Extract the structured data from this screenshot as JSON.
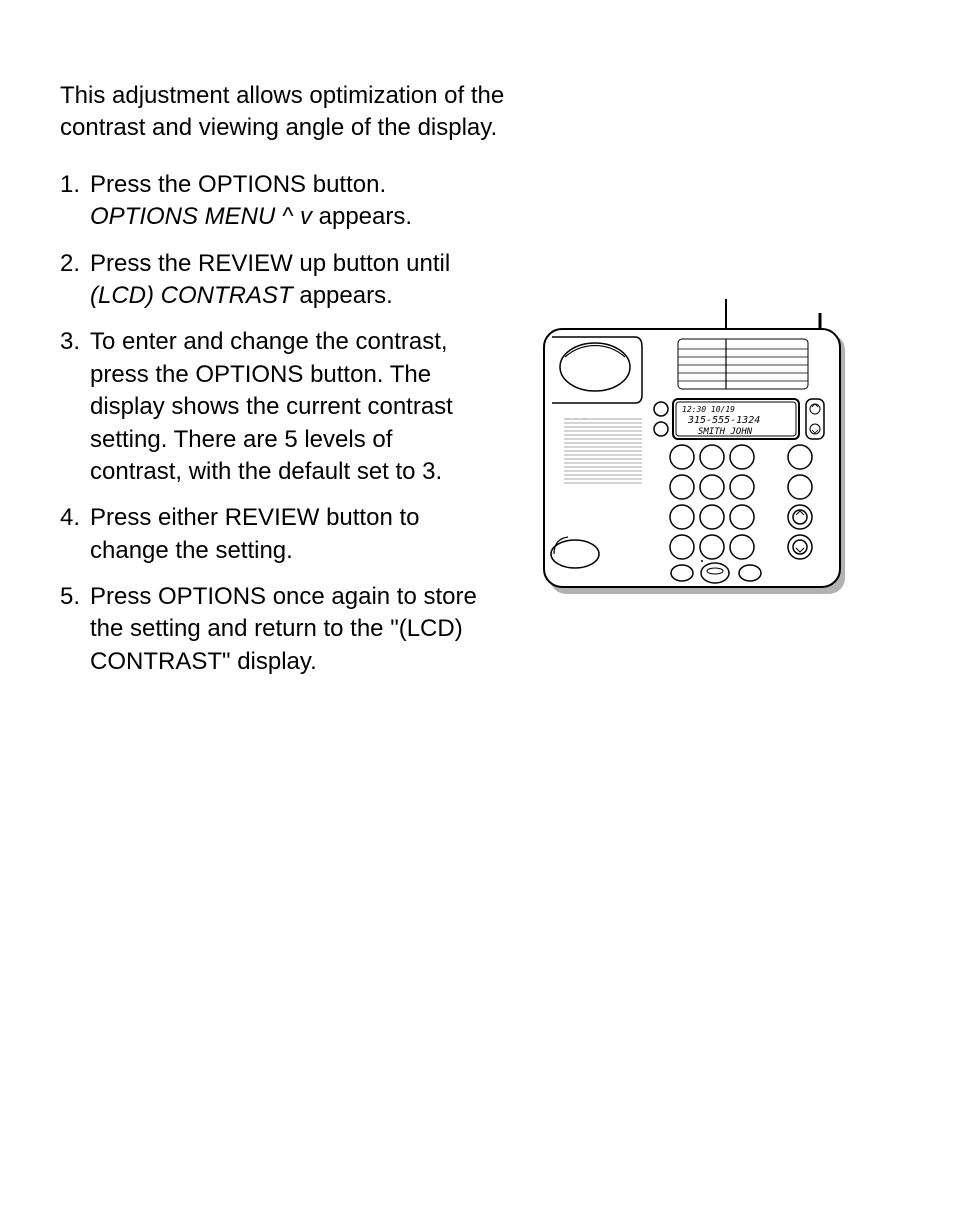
{
  "intro": "This adjustment allows optimization of the contrast and viewing angle of the display.",
  "steps": [
    {
      "num": "1.",
      "parts": [
        {
          "text": "Press the OPTIONS button. ",
          "italic": false
        },
        {
          "text": "OPTIONS MENU ^ v",
          "italic": true
        },
        {
          "text": " appears.",
          "italic": false
        }
      ]
    },
    {
      "num": "2.",
      "parts": [
        {
          "text": "Press the REVIEW up button until ",
          "italic": false
        },
        {
          "text": "(LCD) CONTRAST",
          "italic": true
        },
        {
          "text": " appears.",
          "italic": false
        }
      ]
    },
    {
      "num": "3.",
      "parts": [
        {
          "text": "To enter and change the contrast, press the OPTIONS button. The display shows the current contrast setting. There are 5 levels of contrast, with the default set to 3.",
          "italic": false
        }
      ]
    },
    {
      "num": "4.",
      "parts": [
        {
          "text": "Press either REVIEW button to change the setting.",
          "italic": false
        }
      ]
    },
    {
      "num": "5.",
      "parts": [
        {
          "text": "Press OPTIONS once again to store the setting and return to the \"(LCD) CONTRAST\" display.",
          "italic": false
        }
      ]
    }
  ],
  "lcd": {
    "line1": "12:30   10/19",
    "line2": "315-555-1324",
    "line3": "SMITH JOHN"
  }
}
